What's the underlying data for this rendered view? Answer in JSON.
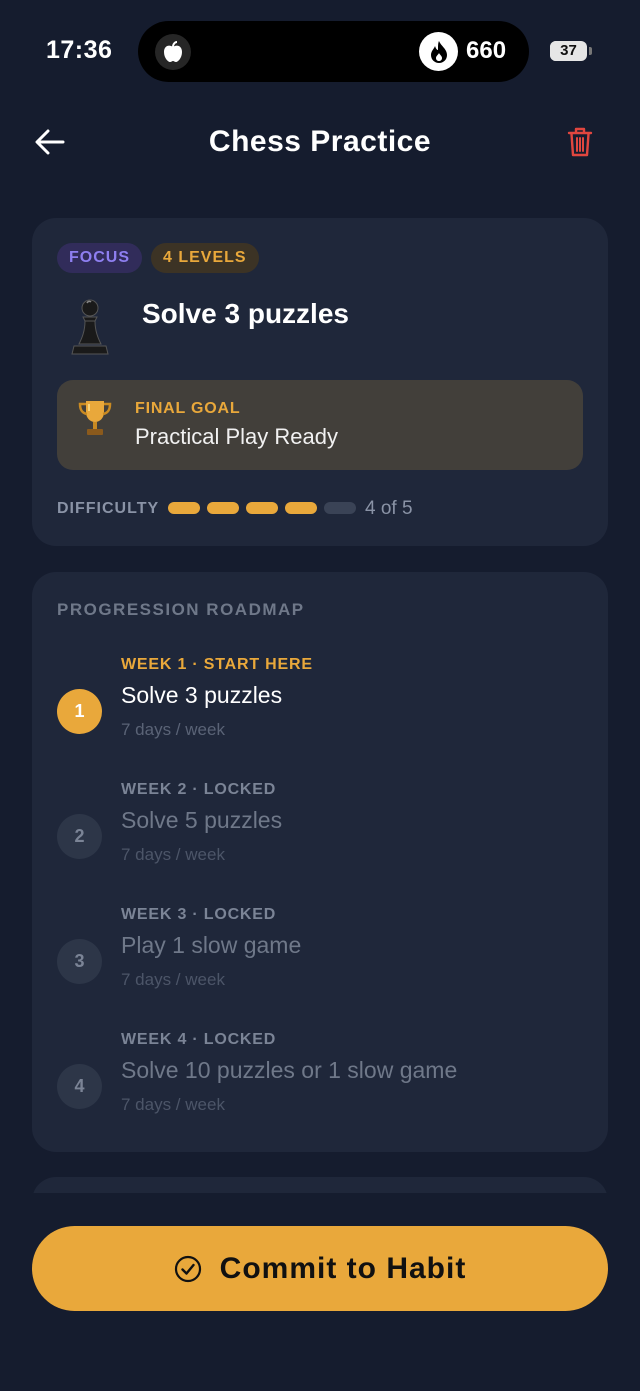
{
  "status_bar": {
    "time": "17:36",
    "streak_count": "660",
    "battery": "37"
  },
  "header": {
    "title": "Chess Practice"
  },
  "summary": {
    "tag_focus": "FOCUS",
    "tag_levels": "4 LEVELS",
    "habit_title": "Solve 3 puzzles",
    "goal_label": "FINAL GOAL",
    "goal_value": "Practical Play Ready",
    "difficulty_label": "DIFFICULTY",
    "difficulty_level": 4,
    "difficulty_max": 5,
    "difficulty_text": "4 of 5"
  },
  "roadmap": {
    "title": "PROGRESSION ROADMAP",
    "steps": [
      {
        "number": "1",
        "meta": "WEEK 1 · START HERE",
        "title": "Solve 3 puzzles",
        "freq": "7 days / week",
        "active": true
      },
      {
        "number": "2",
        "meta": "WEEK 2 · LOCKED",
        "title": "Solve 5 puzzles",
        "freq": "7 days / week",
        "active": false
      },
      {
        "number": "3",
        "meta": "WEEK 3 · LOCKED",
        "title": "Play 1 slow game",
        "freq": "7 days / week",
        "active": false
      },
      {
        "number": "4",
        "meta": "WEEK 4 · LOCKED",
        "title": "Solve 10 puzzles or 1 slow game",
        "freq": "7 days / week",
        "active": false
      }
    ]
  },
  "cta": {
    "label": "Commit to Habit"
  },
  "colors": {
    "background": "#151c2e",
    "card": "#1f273a",
    "accent": "#e9a83b",
    "focus_tag": "#8e7ff0",
    "delete": "#e0463f"
  }
}
